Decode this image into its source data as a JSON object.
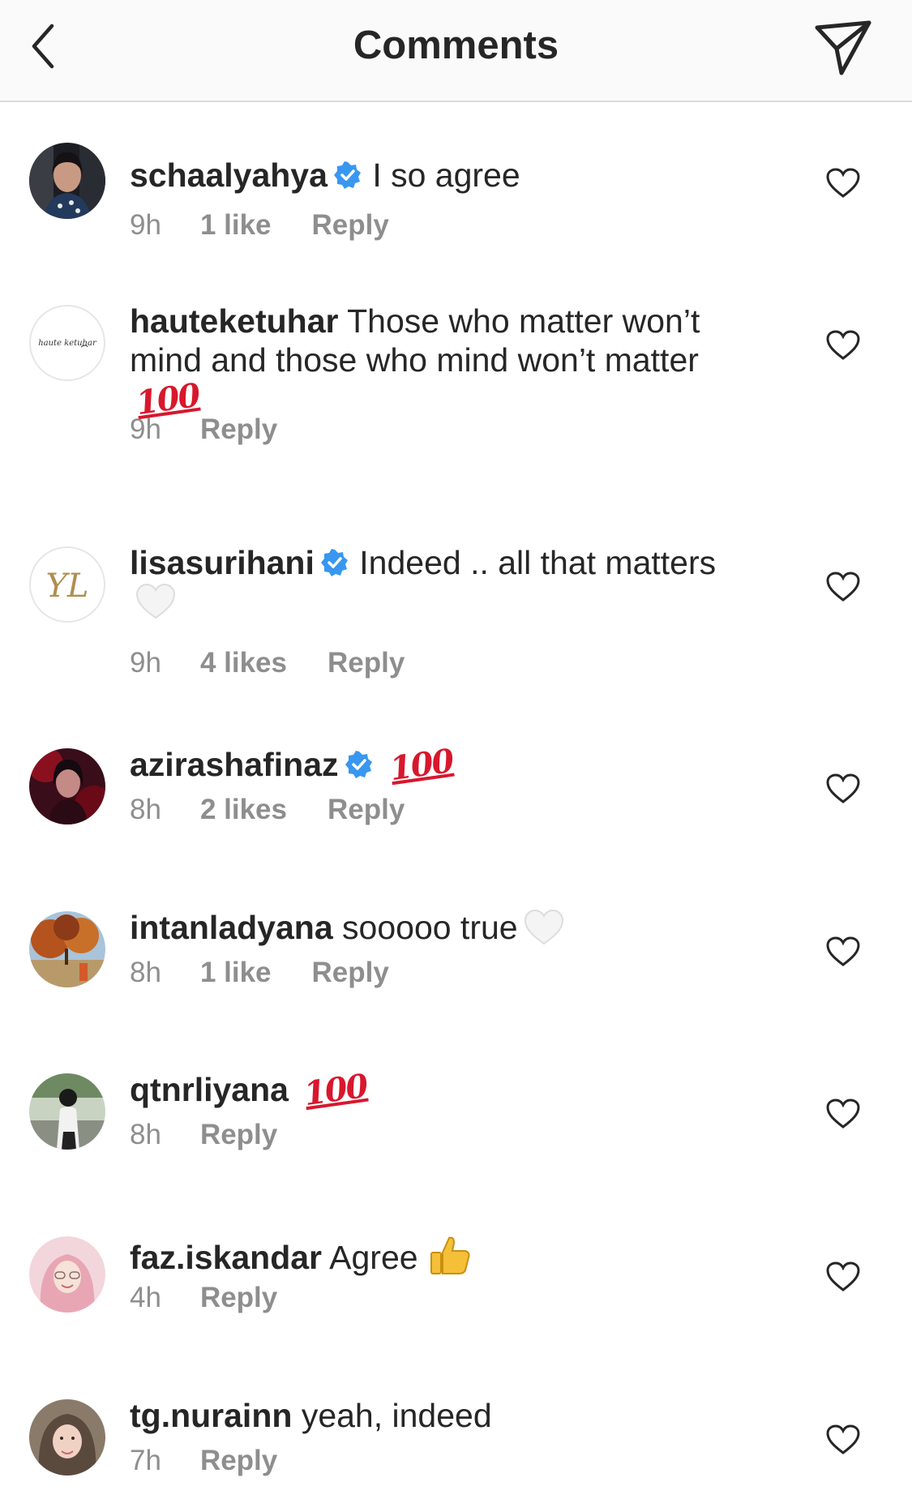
{
  "header": {
    "title": "Comments",
    "back_icon": "chevron-left-icon",
    "share_icon": "paper-plane-icon"
  },
  "colors": {
    "text": "#262626",
    "meta": "#8e8e8e",
    "verified": "#3897f0",
    "header_bg": "#fafafa",
    "emoji_red": "#d8172d"
  },
  "comments": [
    {
      "username": "schaalyahya",
      "verified": true,
      "text": "I so agree",
      "time": "9h",
      "likes": "1 like",
      "reply": "Reply"
    },
    {
      "username": "hauteketuhar",
      "verified": false,
      "text": "Those who matter won’t mind and those who mind won’t matter",
      "emoji": "💯",
      "time": "9h",
      "likes": "",
      "reply": "Reply",
      "avatar_text": "haute ketuhar"
    },
    {
      "username": "lisasurihani",
      "verified": true,
      "text": "Indeed .. all that matters",
      "emoji": "🤍",
      "time": "9h",
      "likes": "4 likes",
      "reply": "Reply",
      "avatar_text": "YL"
    },
    {
      "username": "azirashafinaz",
      "verified": true,
      "text": "",
      "emoji": "💯",
      "time": "8h",
      "likes": "2 likes",
      "reply": "Reply"
    },
    {
      "username": "intanladyana",
      "verified": false,
      "text": "sooooo true",
      "emoji": "🤍",
      "time": "8h",
      "likes": "1 like",
      "reply": "Reply"
    },
    {
      "username": "qtnrliyana",
      "verified": false,
      "text": "",
      "emoji": "💯",
      "time": "8h",
      "likes": "",
      "reply": "Reply"
    },
    {
      "username": "faz.iskandar",
      "verified": false,
      "text": "Agree",
      "emoji": "👍",
      "time": "4h",
      "likes": "",
      "reply": "Reply"
    },
    {
      "username": "tg.nurainn",
      "verified": false,
      "text": "yeah, indeed",
      "time": "7h",
      "likes": "",
      "reply": "Reply"
    }
  ]
}
